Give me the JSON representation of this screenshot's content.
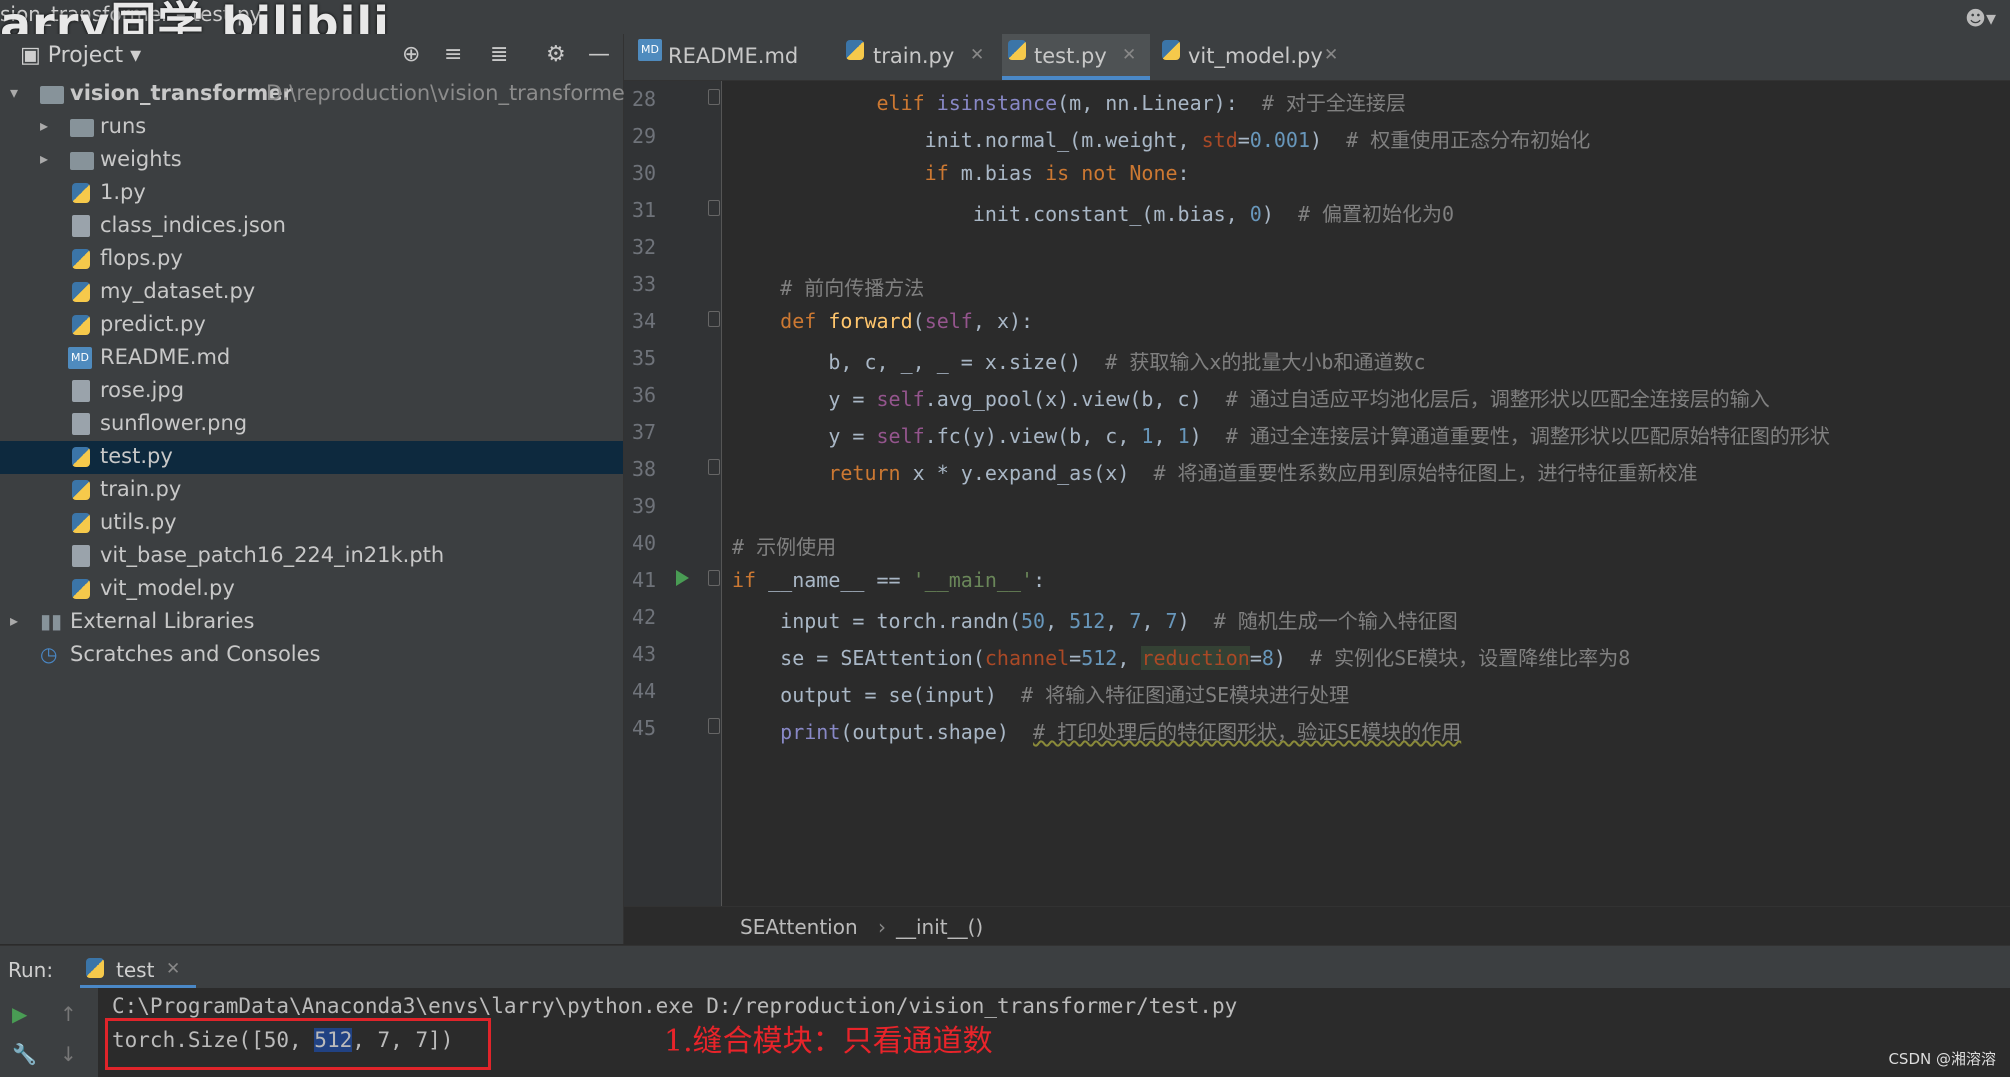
{
  "window": {
    "title_fragment": "sion_transformer – test.py",
    "watermark": "arry同学 bilibili"
  },
  "project": {
    "label": "Project",
    "root_name": "vision_transformer",
    "root_path": "D:\\reproduction\\vision_transformer",
    "items": [
      {
        "name": "runs",
        "type": "folder"
      },
      {
        "name": "weights",
        "type": "folder"
      },
      {
        "name": "1.py",
        "type": "py"
      },
      {
        "name": "class_indices.json",
        "type": "file"
      },
      {
        "name": "flops.py",
        "type": "py"
      },
      {
        "name": "my_dataset.py",
        "type": "py"
      },
      {
        "name": "predict.py",
        "type": "py"
      },
      {
        "name": "README.md",
        "type": "md"
      },
      {
        "name": "rose.jpg",
        "type": "file"
      },
      {
        "name": "sunflower.png",
        "type": "file"
      },
      {
        "name": "test.py",
        "type": "py",
        "selected": true
      },
      {
        "name": "train.py",
        "type": "py"
      },
      {
        "name": "utils.py",
        "type": "py"
      },
      {
        "name": "vit_base_patch16_224_in21k.pth",
        "type": "file"
      },
      {
        "name": "vit_model.py",
        "type": "py"
      }
    ],
    "external_libraries": "External Libraries",
    "scratches": "Scratches and Consoles"
  },
  "tabs": [
    {
      "label": "README.md",
      "icon": "md"
    },
    {
      "label": "train.py",
      "icon": "py"
    },
    {
      "label": "test.py",
      "icon": "py",
      "active": true
    },
    {
      "label": "vit_model.py",
      "icon": "py"
    }
  ],
  "code": {
    "line_numbers": [
      "28",
      "29",
      "30",
      "31",
      "32",
      "33",
      "34",
      "35",
      "36",
      "37",
      "38",
      "39",
      "40",
      "41",
      "42",
      "43",
      "44",
      "45"
    ],
    "comments": {
      "l28": "# 对于全连接层",
      "l29": "# 权重使用正态分布初始化",
      "l31": "# 偏置初始化为0",
      "l33": "# 前向传播方法",
      "l35": "# 获取输入x的批量大小b和通道数c",
      "l36": "# 通过自适应平均池化层后，调整形状以匹配全连接层的输入",
      "l37": "# 通过全连接层计算通道重要性，调整形状以匹配原始特征图的形状",
      "l38": "# 将通道重要性系数应用到原始特征图上，进行特征重新校准",
      "l40": "# 示例使用",
      "l42": "# 随机生成一个输入特征图",
      "l43": "# 实例化SE模块，设置降维比率为8",
      "l44": "# 将输入特征图通过SE模块进行处理",
      "l45": "# 打印处理后的特征图形状，验证SE模块的作用"
    }
  },
  "breadcrumb": {
    "class_name": "SEAttention",
    "method": "__init__()"
  },
  "run": {
    "label": "Run:",
    "tab": "test",
    "command": "C:\\ProgramData\\Anaconda3\\envs\\larry\\python.exe D:/reproduction/vision_transformer/test.py",
    "output_prefix": "torch.Size([50, ",
    "output_highlight": "512",
    "output_suffix": ", 7, 7])",
    "annotation": "1.缝合模块：只看通道数"
  },
  "credit": "CSDN @湘溶溶"
}
